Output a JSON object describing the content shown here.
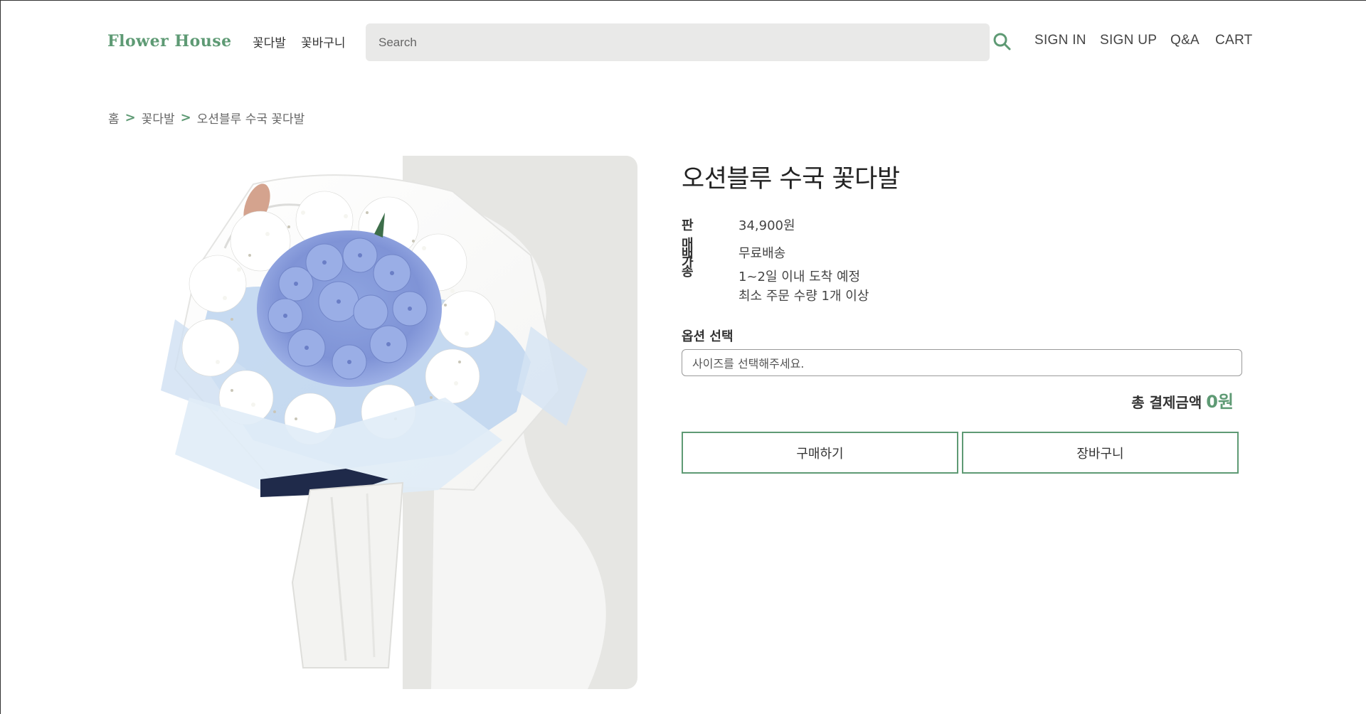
{
  "header": {
    "logo": "Flower House",
    "nav": [
      "꽃다발",
      "꽃바구니"
    ],
    "search_placeholder": "Search",
    "links": [
      "SIGN IN",
      "SIGN UP",
      "Q&A",
      "CART"
    ]
  },
  "breadcrumb": [
    "홈",
    "꽃다발",
    "오션블루 수국 꽃다발"
  ],
  "breadcrumb_separator": ">",
  "product": {
    "title": "오션블루 수국 꽃다발",
    "price_label": "판매가",
    "price": "34,900원",
    "shipping_label": "배송",
    "shipping_lines": [
      "무료배송",
      "1~2일 이내 도착 예정",
      "최소 주문 수량 1개 이상"
    ],
    "option_label": "옵션 선택",
    "option_placeholder": "사이즈를 선택해주세요.",
    "total_label": "총 결제금액",
    "total_value": "0원",
    "buy_button": "구매하기",
    "cart_button": "장바구니"
  },
  "colors": {
    "accent": "#5e9a74",
    "search_bg": "#e9e9e8"
  }
}
